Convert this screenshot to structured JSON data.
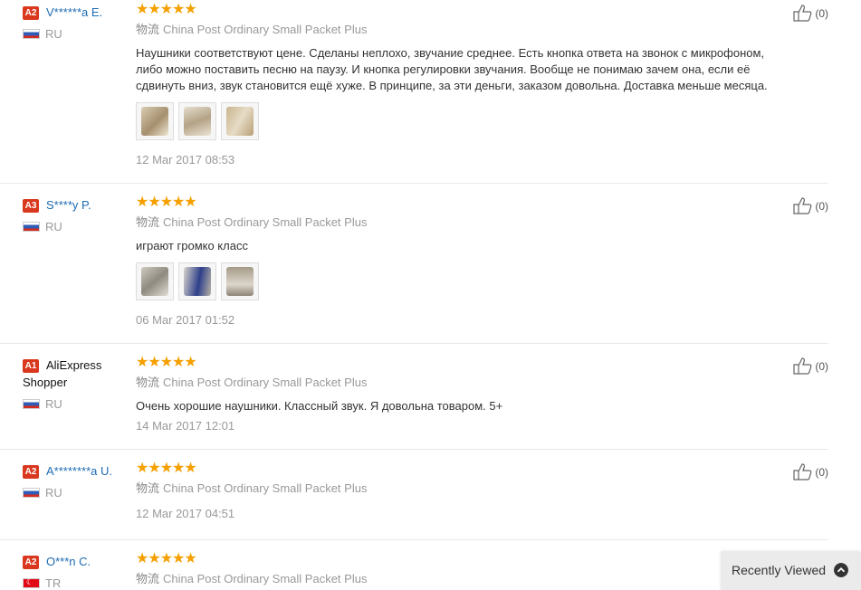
{
  "reviews": [
    {
      "badge": "A2",
      "username": "V******a E.",
      "country": "RU",
      "stars": "★★★★★",
      "shipping_cn": "物流",
      "shipping": "China Post Ordinary Small Packet Plus",
      "text": "Наушники соответствуют цене. Сделаны неплохо, звучание среднее. Есть кнопка ответа на звонок с микрофоном, либо можно поставить песню на паузу. И кнопка регулировки звучания. Вообще не понимаю зачем она, если её сдвинуть вниз, звук становится ещё хуже. В принципе, за эти деньги, заказом довольна. Доставка меньше месяца.",
      "date": "12 Mar 2017 08:53",
      "helpful": "(0)"
    },
    {
      "badge": "A3",
      "username": "S****y P.",
      "country": "RU",
      "stars": "★★★★★",
      "shipping_cn": "物流",
      "shipping": "China Post Ordinary Small Packet Plus",
      "text": "играют громко класс",
      "date": "06 Mar 2017 01:52",
      "helpful": "(0)"
    },
    {
      "badge": "A1",
      "username": "AliExpress Shopper",
      "country": "RU",
      "stars": "★★★★★",
      "shipping_cn": "物流",
      "shipping": "China Post Ordinary Small Packet Plus",
      "text": "Очень хорошие наушники. Классный звук. Я довольна товаром. 5+",
      "date": "14 Mar 2017 12:01",
      "helpful": "(0)"
    },
    {
      "badge": "A2",
      "username": "A********a U.",
      "country": "RU",
      "stars": "★★★★★",
      "shipping_cn": "物流",
      "shipping": "China Post Ordinary Small Packet Plus",
      "date": "12 Mar 2017 04:51",
      "helpful": "(0)"
    },
    {
      "badge": "A2",
      "username": "O***n C.",
      "country": "TR",
      "stars": "★★★★★",
      "shipping_cn": "物流",
      "shipping": "China Post Ordinary Small Packet Plus"
    }
  ],
  "recently_viewed": {
    "label": "Recently Viewed"
  },
  "colors": {
    "badge": "#d9381e",
    "star": "#f5a000",
    "link": "#1d6bb3",
    "muted": "#999999"
  }
}
